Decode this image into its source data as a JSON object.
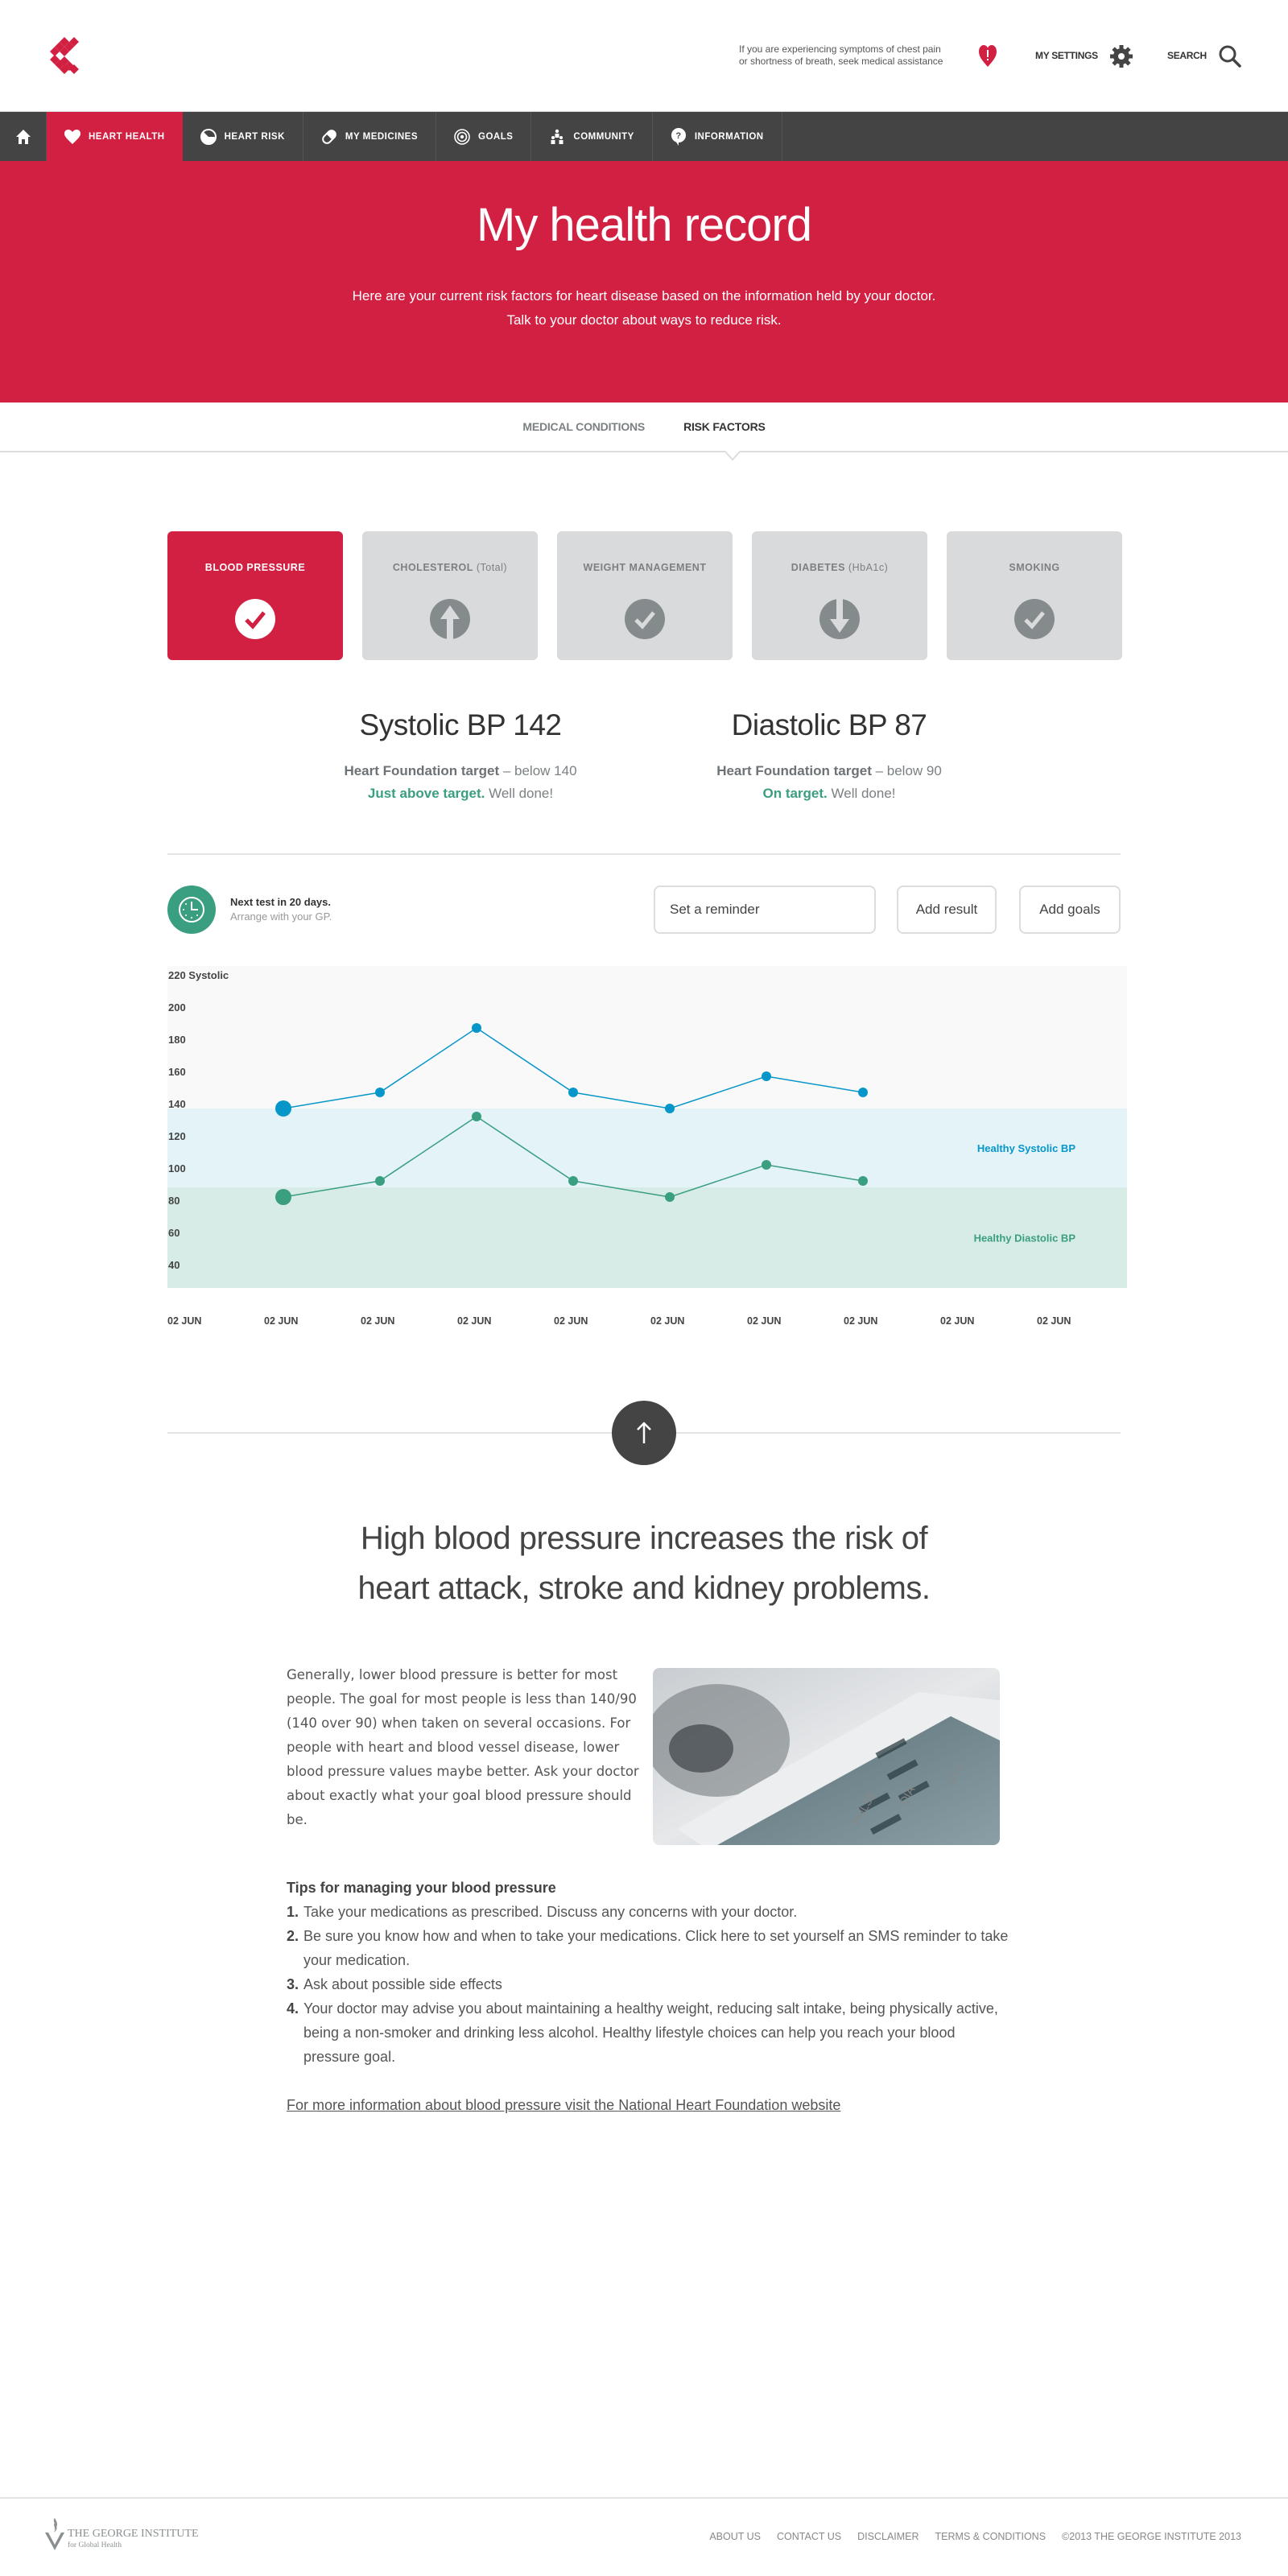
{
  "header": {
    "alert_line1": "If you are experiencing symptoms of chest pain",
    "alert_line2": "or shortness of breath, seek medical assistance",
    "settings_label": "MY SETTINGS",
    "search_label": "SEARCH"
  },
  "nav": {
    "items": [
      {
        "label": "HEART HEALTH",
        "icon": "heart-icon",
        "active": true
      },
      {
        "label": "HEART RISK",
        "icon": "gauge-icon"
      },
      {
        "label": "MY MEDICINES",
        "icon": "pill-icon"
      },
      {
        "label": "GOALS",
        "icon": "target-icon"
      },
      {
        "label": "COMMUNITY",
        "icon": "people-icon"
      },
      {
        "label": "INFORMATION",
        "icon": "question-icon"
      }
    ]
  },
  "hero": {
    "title": "My health record",
    "line1": "Here are your current risk factors for heart disease based on the information held by your doctor.",
    "line2": "Talk to your doctor about ways to reduce risk."
  },
  "subtabs": {
    "items": [
      {
        "label": "MEDICAL CONDITIONS"
      },
      {
        "label": "RISK FACTORS",
        "active": true
      }
    ]
  },
  "cards": [
    {
      "title": "BLOOD PRESSURE",
      "suffix": "",
      "status": "check",
      "active": true
    },
    {
      "title": "CHOLESTEROL",
      "suffix": "(Total)",
      "status": "up"
    },
    {
      "title": "WEIGHT MANAGEMENT",
      "suffix": "",
      "status": "check"
    },
    {
      "title": "DIABETES",
      "suffix": "(HbA1c)",
      "status": "down"
    },
    {
      "title": "SMOKING",
      "suffix": "",
      "status": "check"
    }
  ],
  "readings": {
    "systolic": {
      "title": "Systolic BP 142",
      "target_bold": "Heart Foundation target",
      "target_rest": " – below 140",
      "status_bold": "Just above target.",
      "status_rest": " Well done!"
    },
    "diastolic": {
      "title": "Diastolic BP 87",
      "target_bold": "Heart Foundation target",
      "target_rest": " – below 90",
      "status_bold": "On target.",
      "status_rest": " Well done!"
    }
  },
  "next_test": {
    "title": "Next test in 20 days.",
    "subtitle": "Arrange with your GP."
  },
  "actions": {
    "reminder_placeholder": "Set a reminder",
    "add_result": "Add result",
    "add_goals": "Add goals"
  },
  "colors": {
    "brand_red": "#d22043",
    "systolic": "#0696c9",
    "diastolic": "#3a9e80",
    "systolic_band": "#e3f3f8",
    "diastolic_band": "#d7ece6",
    "plot_bg": "#f9f9f9"
  },
  "chart_data": {
    "type": "line",
    "title": "",
    "ylabel": "Systolic",
    "y_top_label": "220 Systolic",
    "ylim": [
      20,
      220
    ],
    "y_ticks": [
      220,
      200,
      180,
      160,
      140,
      120,
      100,
      80,
      60,
      40
    ],
    "categories": [
      "02 JUN",
      "02 JUN",
      "02 JUN",
      "02 JUN",
      "02 JUN",
      "02 JUN",
      "02 JUN",
      "02 JUN",
      "02 JUN",
      "02 JUN"
    ],
    "series": [
      {
        "name": "Systolic",
        "values": [
          null,
          137,
          147,
          187,
          147,
          137,
          157,
          147,
          null,
          null
        ]
      },
      {
        "name": "Diastolic",
        "values": [
          null,
          82,
          92,
          132,
          92,
          82,
          102,
          92,
          null,
          null
        ]
      }
    ],
    "bands": [
      {
        "label": "Healthy Systolic BP",
        "from": 88,
        "to": 137
      },
      {
        "label": "Healthy Diastolic BP",
        "from": 26,
        "to": 88
      }
    ],
    "grid": false
  },
  "info": {
    "headline_line1": "High blood pressure increases the risk of",
    "headline_line2": "heart attack, stroke and kidney problems.",
    "intro": "Generally, lower blood pressure is better for most people. The goal for most people is less than 140/90 (140 over 90) when taken on several occasions. For people with heart and blood vessel disease, lower blood pressure values maybe better. Ask your doctor about exactly what your goal blood pressure should be.",
    "photo_alt": "Blood pressure monitor",
    "tips_title": "Tips for managing your blood pressure",
    "tips": [
      "Take your medications as prescribed. Discuss any concerns with your doctor.",
      "Be sure you know how and when to take your medications. Click here to set yourself an SMS reminder to take your medication.",
      "Ask about possible side effects",
      "Your doctor may advise you about maintaining a healthy weight, reducing salt intake, being physically active, being a non-smoker and drinking less alcohol. Healthy lifestyle choices can help you reach your blood pressure goal."
    ],
    "more_link": "For more information about blood pressure visit the National Heart Foundation website"
  },
  "footer": {
    "org_name": "THE GEORGE INSTITUTE",
    "org_sub": "for Global Health",
    "links": [
      "ABOUT US",
      "CONTACT US",
      "DISCLAIMER",
      "TERMS & CONDITIONS"
    ],
    "copyright": "©2013 THE GEORGE INSTITUTE 2013"
  }
}
